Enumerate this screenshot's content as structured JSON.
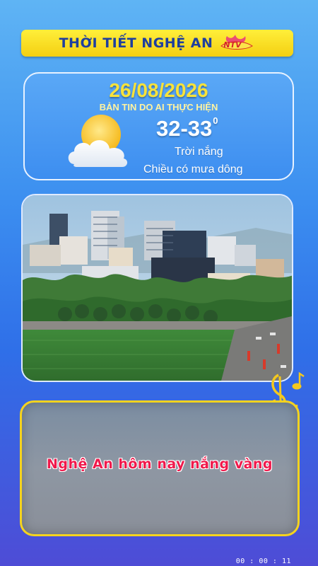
{
  "header": {
    "title": "THỜI TIẾT NGHỆ AN",
    "logo_text": "NTV"
  },
  "weather": {
    "date": "26/08/2026",
    "subtitle": "BẢN TIN DO AI THỰC HIỆN",
    "temperature": "32-33",
    "temperature_unit": "0",
    "condition_line1": "Trời nắng",
    "condition_line2": "Chiều có mưa dông",
    "icon": "sun-behind-cloud-icon"
  },
  "photo": {
    "icon": "city-skyline-photo"
  },
  "caption": {
    "text": "Nghệ An hôm nay nắng vàng"
  },
  "timecode": "00 : 00 : 11",
  "colors": {
    "header_bg": "#f4d21a",
    "header_text": "#1f3f9e",
    "date_color": "#f7e23a",
    "caption_text": "#f01a4c",
    "caption_border": "#f5d31e"
  }
}
